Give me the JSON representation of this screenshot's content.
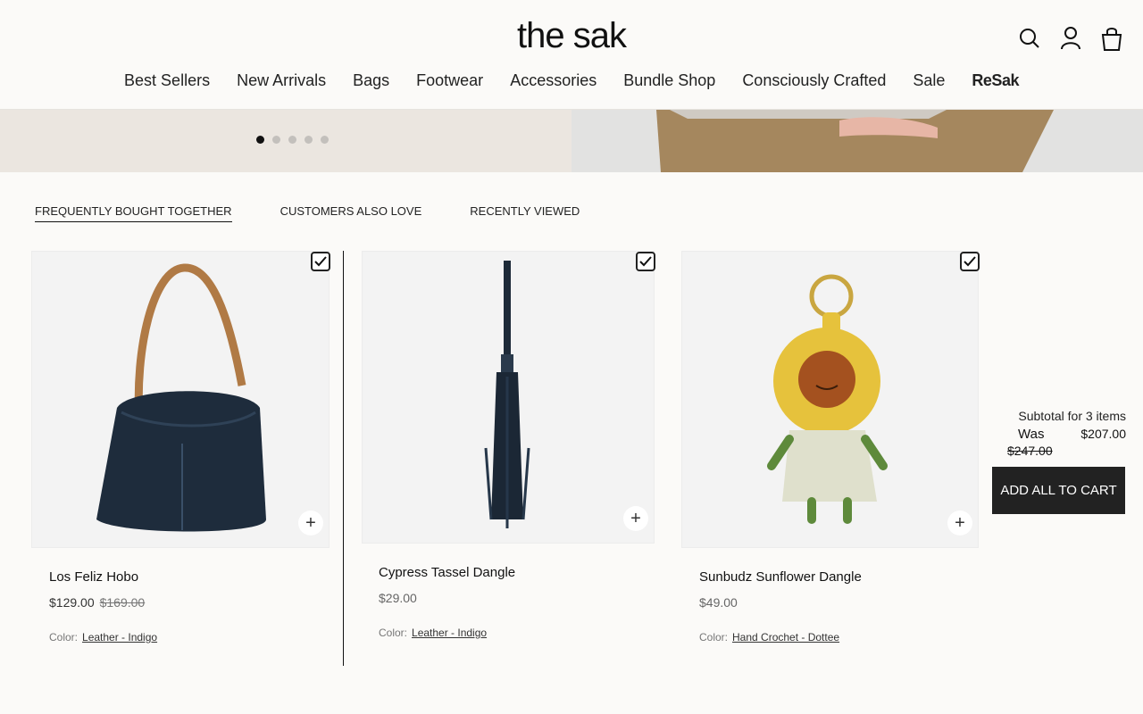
{
  "brand": {
    "logo": "the sak"
  },
  "header_icons": [
    "search-icon",
    "account-icon",
    "bag-icon"
  ],
  "nav": [
    "Best Sellers",
    "New Arrivals",
    "Bags",
    "Footwear",
    "Accessories",
    "Bundle Shop",
    "Consciously Crafted",
    "Sale",
    "ReSak"
  ],
  "carousel": {
    "total": 5,
    "active": 1
  },
  "tabs": [
    "FREQUENTLY BOUGHT TOGETHER",
    "CUSTOMERS ALSO LOVE",
    "RECENTLY VIEWED"
  ],
  "products": [
    {
      "name": "Los Feliz Hobo",
      "price": "$129.00",
      "old_price": "$169.00",
      "color_label": "Color:",
      "color": "Leather - Indigo"
    },
    {
      "name": "Cypress Tassel Dangle",
      "price": "$29.00",
      "color_label": "Color:",
      "color": "Leather - Indigo"
    },
    {
      "name": "Sunbudz Sunflower Dangle",
      "price": "$49.00",
      "color_label": "Color:",
      "color": "Hand Crochet - Dottee"
    }
  ],
  "summary": {
    "subtotal_label": "Subtotal for 3 items",
    "was_label": "Was",
    "new_total": "$207.00",
    "old_total": "$247.00",
    "button": "ADD ALL TO CART"
  },
  "colors": {
    "accent": "#222222",
    "background": "#fbfaf8"
  }
}
